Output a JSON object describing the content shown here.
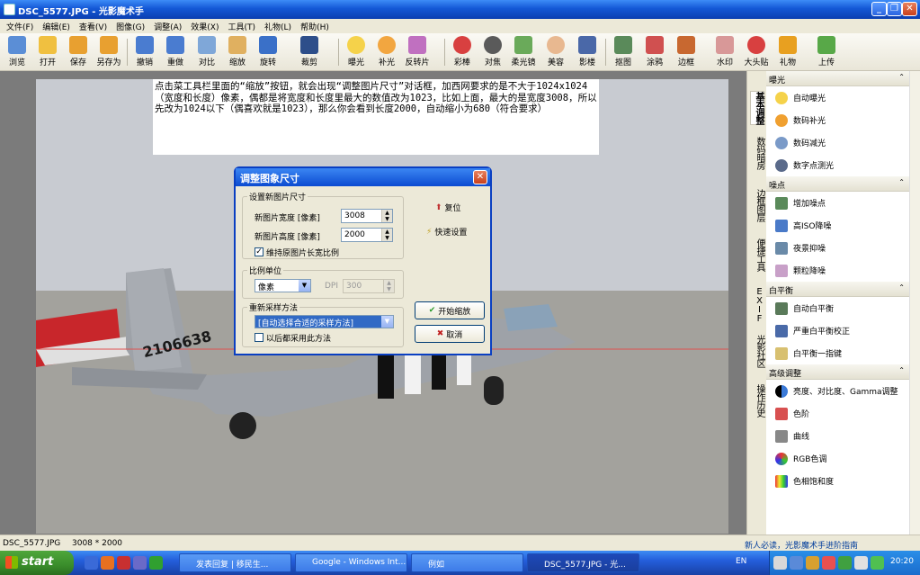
{
  "window": {
    "title": "DSC_5577.JPG - 光影魔术手"
  },
  "menu": [
    "文件(F)",
    "编辑(E)",
    "查看(V)",
    "图像(G)",
    "调整(A)",
    "效果(X)",
    "工具(T)",
    "礼物(L)",
    "帮助(H)"
  ],
  "toolbar": [
    "浏览",
    "打开",
    "保存",
    "另存为",
    "撤销",
    "重做",
    "对比",
    "缩放",
    "旋转",
    "裁剪",
    "曝光",
    "补光",
    "反转片",
    "影楼",
    "对焦",
    "柔光镜",
    "美容",
    "影楼",
    "抠图",
    "涂鸦",
    "边框",
    "水印",
    "大头贴",
    "礼物",
    "上传"
  ],
  "note": "点击菜工具栏里面的“缩放”按钮，就会出现“调整图片尺寸”对话框，加西网要求的是不大于1024x1024（宽度和长度）像素，偶都是将宽度和长度里最大的数值改为1023，比如上面，最大的是宽度3008，所以先改为1024以下（偶喜欢就是1023），那么你会看到长度2000，自动缩小为680（符合要求）",
  "dialog": {
    "title": "调整图象尺寸",
    "group_size": "设置新图片尺寸",
    "width_label": "新图片宽度 [像素]",
    "width_value": "3008",
    "height_label": "新图片高度 [像素]",
    "height_value": "2000",
    "keep_ratio": "维持原图片长宽比例",
    "reset": "复位",
    "quick": "快速设置",
    "group_unit": "比例单位",
    "unit_value": "像素",
    "dpi_label": "DPI",
    "dpi_value": "300",
    "group_resample": "重新采样方法",
    "resample_value": "[自动选择合适的采样方法]",
    "later_use": "以后都采用此方法",
    "start": "开始缩放",
    "cancel": "取消"
  },
  "vtabs": [
    "基本调整",
    "数码暗房",
    "边框图层",
    "便捷工具",
    "EXIF",
    "光影社区",
    "操作历史"
  ],
  "panel": [
    {
      "title": "曝光",
      "items": [
        "自动曝光",
        "数码补光",
        "数码减光",
        "数字点测光"
      ]
    },
    {
      "title": "噪点",
      "items": [
        "增加噪点",
        "高ISO降噪",
        "夜景抑噪",
        "颗粒降噪"
      ]
    },
    {
      "title": "白平衡",
      "items": [
        "自动白平衡",
        "严重白平衡校正",
        "白平衡一指键"
      ]
    },
    {
      "title": "高级调整",
      "items": [
        "亮度、对比度、Gamma调整",
        "色阶",
        "曲线",
        "RGB色调",
        "色相饱和度"
      ]
    }
  ],
  "status": {
    "file": "DSC_5577.JPG",
    "size": "3008 * 2000",
    "hint": "新人必读，光影魔术手进阶指南"
  },
  "taskbar": {
    "start": "start",
    "tasks": [
      "发表回复 | 移民生...",
      "Google - Windows Int...",
      "例如",
      "DSC_5577.JPG - 光..."
    ],
    "lang": "EN",
    "time": "20:20"
  },
  "photo": {
    "tail_number": "2106638"
  }
}
